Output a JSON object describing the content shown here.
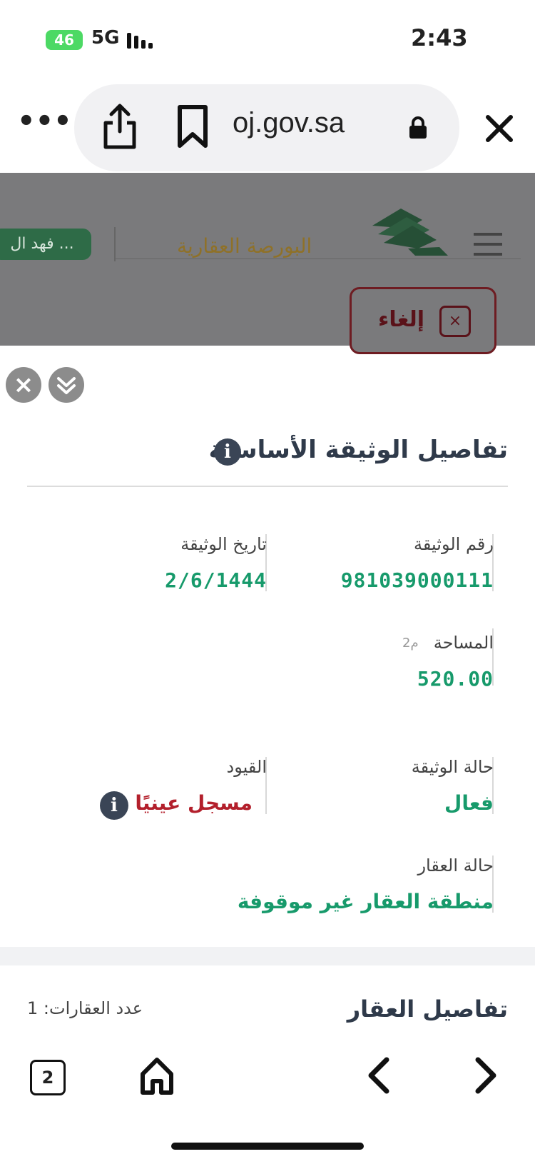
{
  "status_bar": {
    "battery": "46",
    "network": "5G",
    "time": "2:43"
  },
  "browser": {
    "url": "oj.gov.sa",
    "more_label": "•••",
    "open_tabs": "2"
  },
  "site_header": {
    "logo_text": "البورصة العقارية",
    "search_chip": "فهد ال ..."
  },
  "cancel_button": {
    "label": "إلغاء",
    "icon": "×"
  },
  "panel": {
    "close_icon": "×"
  },
  "document_details": {
    "title": "تفاصيل الوثيقة الأساسية",
    "info_icon": "i",
    "fields": {
      "doc_number": {
        "label": "رقم الوثيقة",
        "value": "981039000111"
      },
      "doc_date": {
        "label": "تاريخ الوثيقة",
        "value": "2/6/1444"
      },
      "area": {
        "label": "المساحة",
        "unit": "م2",
        "value": "520.00"
      },
      "doc_status": {
        "label": "حالة الوثيقة",
        "value": "فعال"
      },
      "restrictions": {
        "label": "القيود",
        "value": "مسجل عينيًا",
        "info_icon": "i"
      },
      "property_status": {
        "label": "حالة العقار",
        "value": "منطقة العقار غير موقوفة"
      }
    }
  },
  "property_details": {
    "title": "تفاصيل العقار",
    "count": "عدد العقارات: 1"
  },
  "colors": {
    "accent_green": "#179a6b",
    "danger_red": "#b3202c",
    "dark_slate": "#2f3a4a"
  }
}
